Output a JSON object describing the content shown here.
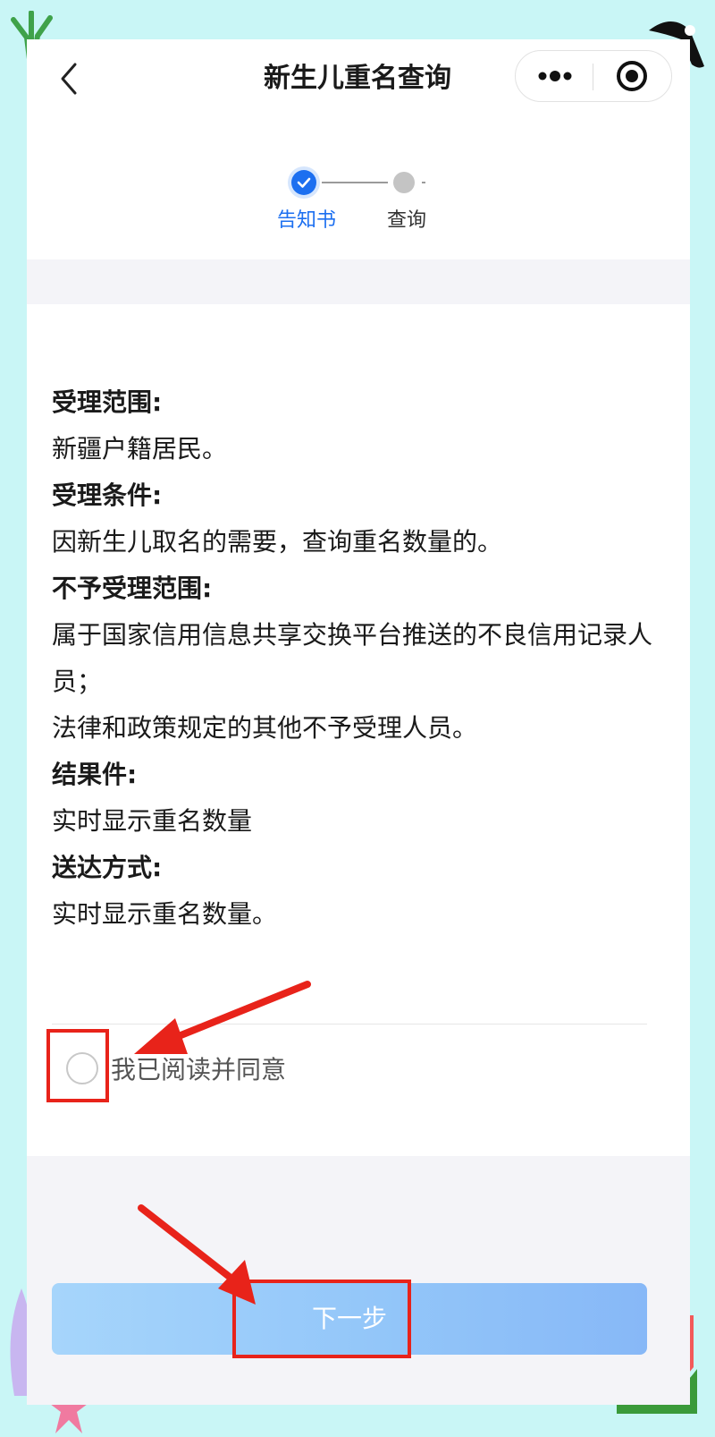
{
  "navbar": {
    "title": "新生儿重名查询",
    "more_icon": "more-dots-icon",
    "close_icon": "target-close-icon"
  },
  "steps": {
    "items": [
      {
        "label": "告知书",
        "state": "done"
      },
      {
        "label": "查询",
        "state": "pending"
      }
    ],
    "active_color": "#1c6ff0"
  },
  "notice": [
    {
      "heading": "受理范围:",
      "text": [
        "新疆户籍居民。"
      ]
    },
    {
      "heading": "受理条件:",
      "text": [
        "因新生儿取名的需要，查询重名数量的。"
      ]
    },
    {
      "heading": "不予受理范围:",
      "text": [
        "属于国家信用信息共享交换平台推送的不良信用记录人员；",
        "法律和政策规定的其他不予受理人员。"
      ]
    },
    {
      "heading": "结果件:",
      "text": [
        "实时显示重名数量"
      ]
    },
    {
      "heading": "送达方式:",
      "text": [
        "实时显示重名数量。"
      ]
    }
  ],
  "agree": {
    "label": "我已阅读并同意",
    "checked": false
  },
  "next_button": {
    "label": "下一步",
    "enabled": false
  },
  "annotations": {
    "highlight_color": "#e8231a"
  }
}
